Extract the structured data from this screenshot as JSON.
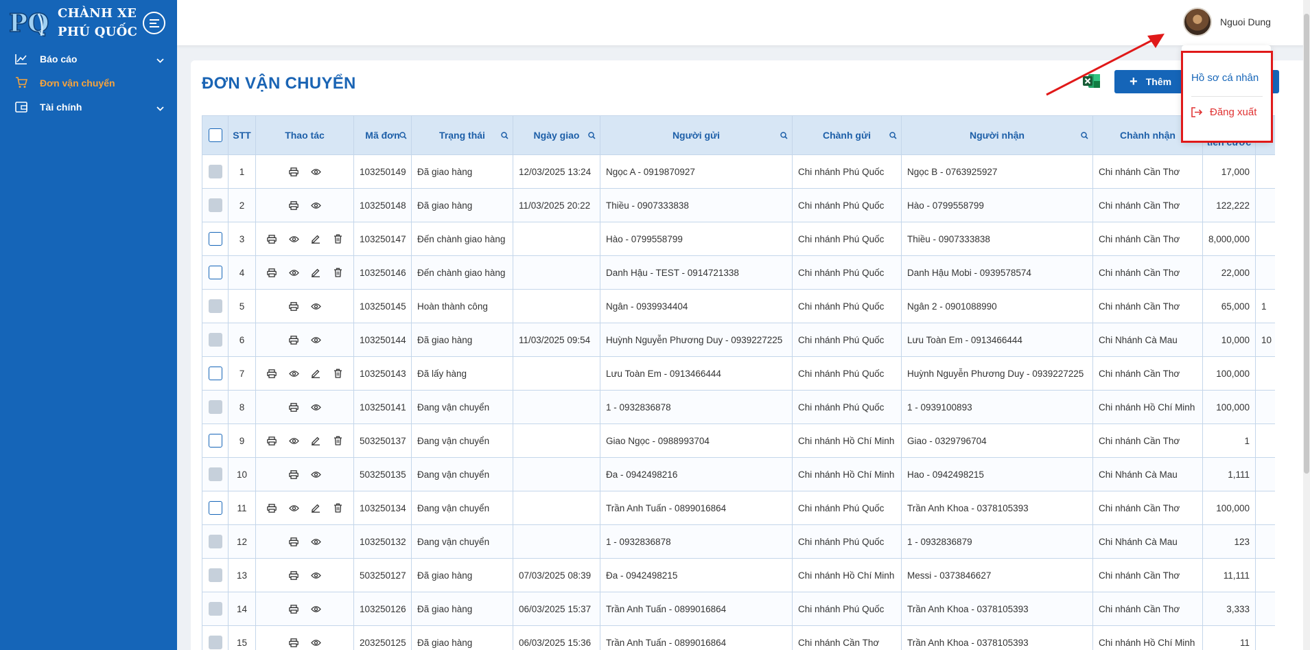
{
  "brand": {
    "line1": "CHÀNH XE",
    "line2": "PHÚ QUỐC",
    "logo_text": "PQ"
  },
  "sidebar": {
    "items": [
      {
        "label": "Báo cáo",
        "icon": "chart-line-icon",
        "has_children": true,
        "active": false
      },
      {
        "label": "Đơn vận chuyển",
        "icon": "cart-icon",
        "has_children": false,
        "active": true
      },
      {
        "label": "Tài chính",
        "icon": "wallet-icon",
        "has_children": true,
        "active": false
      }
    ]
  },
  "header": {
    "user_name": "Nguoi Dung"
  },
  "user_menu": {
    "profile": "Hồ sơ cá nhân",
    "logout": "Đăng xuất"
  },
  "page": {
    "title": "ĐƠN VẬN CHUYỂN",
    "add_button": "Thêm"
  },
  "colors": {
    "primary": "#1565b8",
    "active": "#f6a33c",
    "highlight": "#e01919"
  },
  "table": {
    "columns": {
      "stt": "STT",
      "actions": "Thao tác",
      "code": "Mã đơn",
      "status": "Trạng thái",
      "delivery_date": "Ngày giao",
      "sender": "Người gửi",
      "sender_branch": "Chành gửi",
      "receiver": "Người nhận",
      "receiver_branch": "Chành nhận",
      "fee": "tiền cước"
    },
    "rows": [
      {
        "stt": "1",
        "editable": false,
        "code": "103250149",
        "status": "Đã giao hàng",
        "date": "12/03/2025 13:24",
        "sender": "Ngọc A - 0919870927",
        "sender_branch": "Chi nhánh Phú Quốc",
        "receiver": "Ngọc B - 0763925927",
        "receiver_branch": "Chi nhánh Cần Thơ",
        "fee": "17,000",
        "extra": ""
      },
      {
        "stt": "2",
        "editable": false,
        "code": "103250148",
        "status": "Đã giao hàng",
        "date": "11/03/2025 20:22",
        "sender": "Thiều - 0907333838",
        "sender_branch": "Chi nhánh Phú Quốc",
        "receiver": "Hào - 0799558799",
        "receiver_branch": "Chi nhánh Cần Thơ",
        "fee": "122,222",
        "extra": ""
      },
      {
        "stt": "3",
        "editable": true,
        "code": "103250147",
        "status": "Đến chành giao hàng",
        "date": "",
        "sender": "Hào - 0799558799",
        "sender_branch": "Chi nhánh Phú Quốc",
        "receiver": "Thiều - 0907333838",
        "receiver_branch": "Chi nhánh Cần Thơ",
        "fee": "8,000,000",
        "extra": ""
      },
      {
        "stt": "4",
        "editable": true,
        "code": "103250146",
        "status": "Đến chành giao hàng",
        "date": "",
        "sender": "Danh Hậu - TEST - 0914721338",
        "sender_branch": "Chi nhánh Phú Quốc",
        "receiver": "Danh Hậu Mobi - 0939578574",
        "receiver_branch": "Chi nhánh Cần Thơ",
        "fee": "22,000",
        "extra": ""
      },
      {
        "stt": "5",
        "editable": false,
        "code": "103250145",
        "status": "Hoàn thành công",
        "date": "",
        "sender": "Ngân - 0939934404",
        "sender_branch": "Chi nhánh Phú Quốc",
        "receiver": "Ngân 2 - 0901088990",
        "receiver_branch": "Chi nhánh Cần Thơ",
        "fee": "65,000",
        "extra": "1"
      },
      {
        "stt": "6",
        "editable": false,
        "code": "103250144",
        "status": "Đã giao hàng",
        "date": "11/03/2025 09:54",
        "sender": "Huỳnh Nguyễn Phương Duy - 0939227225",
        "sender_branch": "Chi nhánh Phú Quốc",
        "receiver": "Lưu Toàn Em - 0913466444",
        "receiver_branch": "Chi Nhánh Cà Mau",
        "fee": "10,000",
        "extra": "10"
      },
      {
        "stt": "7",
        "editable": true,
        "code": "103250143",
        "status": "Đã lấy hàng",
        "date": "",
        "sender": "Lưu Toàn Em - 0913466444",
        "sender_branch": "Chi nhánh Phú Quốc",
        "receiver": "Huỳnh Nguyễn Phương Duy - 0939227225",
        "receiver_branch": "Chi nhánh Cần Thơ",
        "fee": "100,000",
        "extra": ""
      },
      {
        "stt": "8",
        "editable": false,
        "code": "103250141",
        "status": "Đang vận chuyển",
        "date": "",
        "sender": "1 - 0932836878",
        "sender_branch": "Chi nhánh Phú Quốc",
        "receiver": "1 - 0939100893",
        "receiver_branch": "Chi nhánh Hồ Chí Minh",
        "fee": "100,000",
        "extra": ""
      },
      {
        "stt": "9",
        "editable": true,
        "code": "503250137",
        "status": "Đang vận chuyển",
        "date": "",
        "sender": "Giao Ngọc - 0988993704",
        "sender_branch": "Chi nhánh Hồ Chí Minh",
        "receiver": "Giao - 0329796704",
        "receiver_branch": "Chi nhánh Cần Thơ",
        "fee": "1",
        "extra": ""
      },
      {
        "stt": "10",
        "editable": false,
        "code": "503250135",
        "status": "Đang vận chuyển",
        "date": "",
        "sender": "Đa - 0942498216",
        "sender_branch": "Chi nhánh Hồ Chí Minh",
        "receiver": "Hao - 0942498215",
        "receiver_branch": "Chi Nhánh Cà Mau",
        "fee": "1,111",
        "extra": ""
      },
      {
        "stt": "11",
        "editable": true,
        "code": "103250134",
        "status": "Đang vận chuyển",
        "date": "",
        "sender": "Trần Anh Tuấn - 0899016864",
        "sender_branch": "Chi nhánh Phú Quốc",
        "receiver": "Trần Anh Khoa - 0378105393",
        "receiver_branch": "Chi nhánh Cần Thơ",
        "fee": "100,000",
        "extra": ""
      },
      {
        "stt": "12",
        "editable": false,
        "code": "103250132",
        "status": "Đang vận chuyển",
        "date": "",
        "sender": "1 - 0932836878",
        "sender_branch": "Chi nhánh Phú Quốc",
        "receiver": "1 - 0932836879",
        "receiver_branch": "Chi Nhánh Cà Mau",
        "fee": "123",
        "extra": ""
      },
      {
        "stt": "13",
        "editable": false,
        "code": "503250127",
        "status": "Đã giao hàng",
        "date": "07/03/2025 08:39",
        "sender": "Đa - 0942498215",
        "sender_branch": "Chi nhánh Hồ Chí Minh",
        "receiver": "Messi - 0373846627",
        "receiver_branch": "Chi nhánh Cần Thơ",
        "fee": "11,111",
        "extra": ""
      },
      {
        "stt": "14",
        "editable": false,
        "code": "103250126",
        "status": "Đã giao hàng",
        "date": "06/03/2025 15:37",
        "sender": "Trần Anh Tuấn - 0899016864",
        "sender_branch": "Chi nhánh Phú Quốc",
        "receiver": "Trần Anh Khoa - 0378105393",
        "receiver_branch": "Chi nhánh Cần Thơ",
        "fee": "3,333",
        "extra": ""
      },
      {
        "stt": "15",
        "editable": false,
        "code": "203250125",
        "status": "Đã giao hàng",
        "date": "06/03/2025 15:36",
        "sender": "Trần Anh Tuấn - 0899016864",
        "sender_branch": "Chi nhánh Cần Thơ",
        "receiver": "Trần Anh Khoa - 0378105393",
        "receiver_branch": "Chi nhánh Hồ Chí Minh",
        "fee": "11",
        "extra": ""
      }
    ]
  }
}
